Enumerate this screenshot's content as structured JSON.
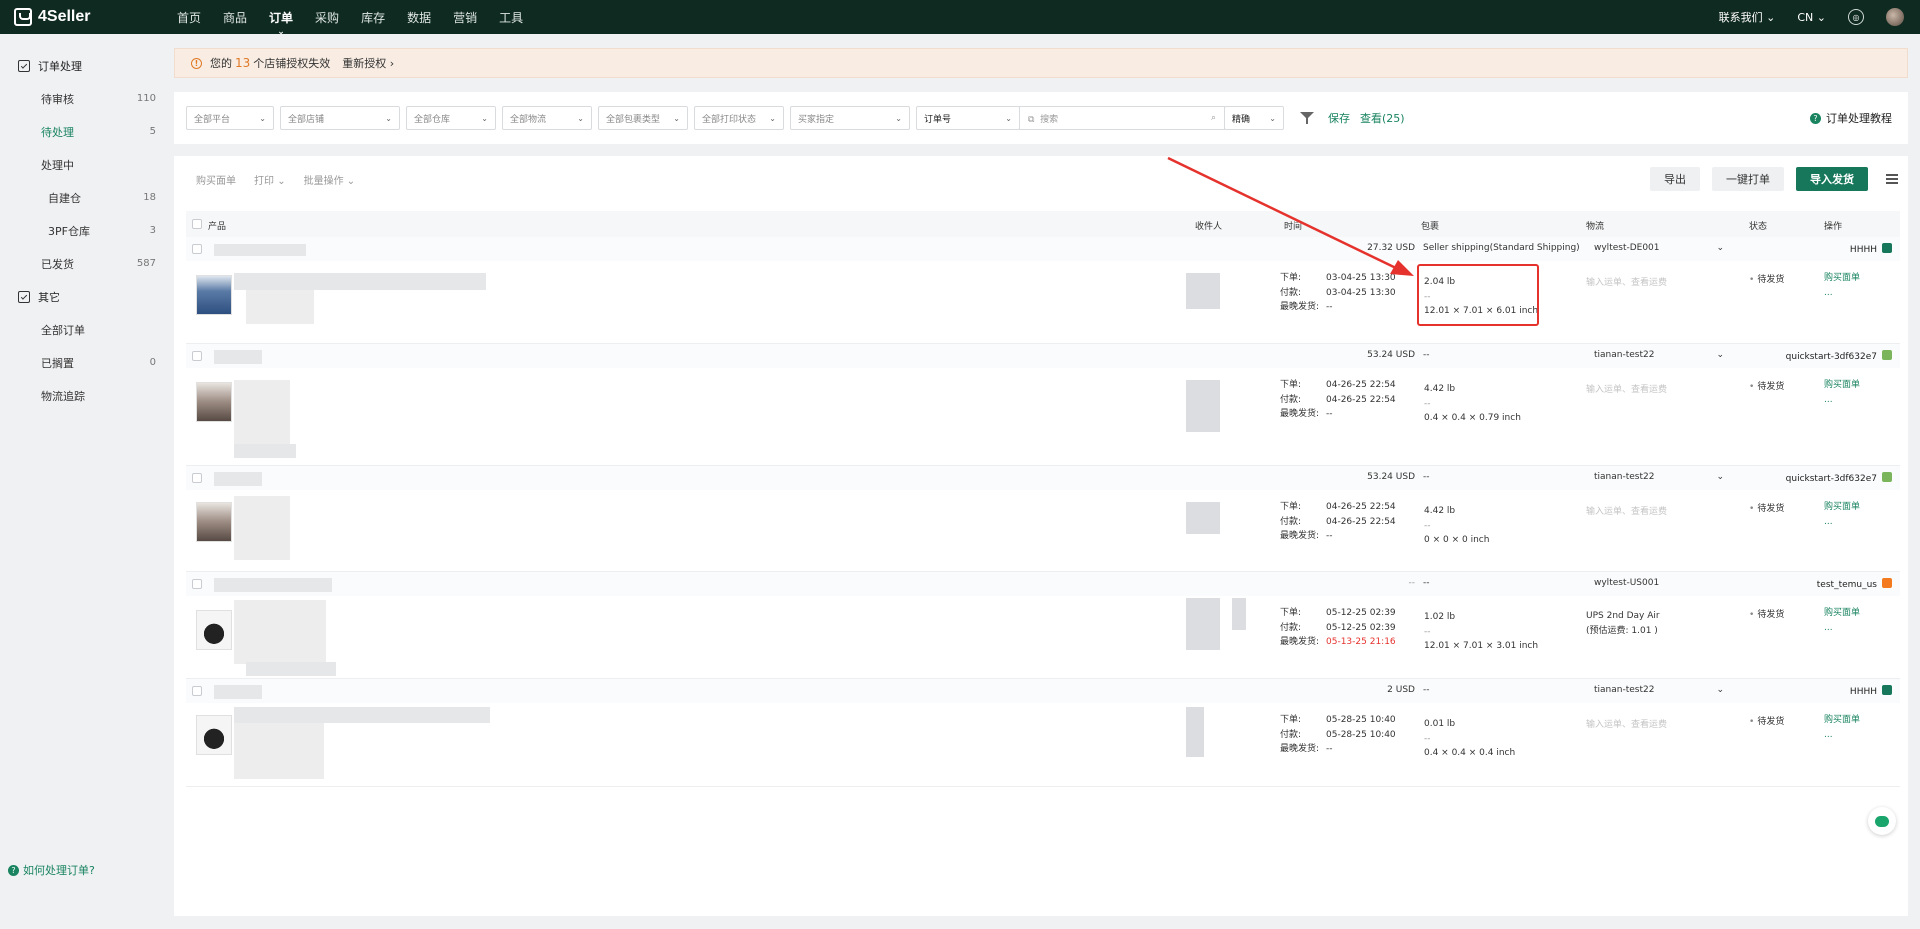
{
  "topnav": {
    "logo": "4Seller",
    "items": [
      "首页",
      "商品",
      "订单",
      "采购",
      "库存",
      "数据",
      "营销",
      "工具"
    ],
    "active_index": 2,
    "contact": "联系我们",
    "lang": "CN"
  },
  "sidebar": {
    "group1": "订单处理",
    "items": [
      {
        "label": "待审核",
        "count": "110"
      },
      {
        "label": "待处理",
        "count": "5"
      },
      {
        "label": "处理中",
        "count": ""
      },
      {
        "label": "自建仓",
        "count": "18"
      },
      {
        "label": "3PF仓库",
        "count": "3"
      },
      {
        "label": "已发货",
        "count": "587"
      }
    ],
    "group2": "其它",
    "items2": [
      {
        "label": "全部订单",
        "count": ""
      },
      {
        "label": "已搁置",
        "count": "0"
      },
      {
        "label": "物流追踪",
        "count": ""
      }
    ],
    "help": "如何处理订单?"
  },
  "alert": {
    "prefix": "您的",
    "count": "13",
    "suffix": "个店铺授权失效",
    "reauth": "重新授权"
  },
  "filters": {
    "platform": "全部平台",
    "store": "全部店铺",
    "warehouse": "全部仓库",
    "logistics": "全部物流",
    "package_type": "全部包裹类型",
    "print_status": "全部打印状态",
    "buyer": "买家指定",
    "order_no": "订单号",
    "search_placeholder": "搜索",
    "match": "精确",
    "save": "保存",
    "view": "查看(25)",
    "tutorial": "订单处理教程"
  },
  "toolbar": {
    "buy_label": "购买面单",
    "print": "打印",
    "batch": "批量操作",
    "export": "导出",
    "one_click": "一键打单",
    "import_ship": "导入发货"
  },
  "columns": {
    "product": "产品",
    "receiver": "收件人",
    "time": "时间",
    "package": "包裹",
    "logistics": "物流",
    "status": "状态",
    "action": "操作"
  },
  "labels": {
    "ordered": "下单:",
    "paid": "付款:",
    "latest": "最晚发货:",
    "tracking_placeholder": "输入运单、查看运费",
    "buy_label": "购买面单",
    "more": "...",
    "dash": "--"
  },
  "orders": [
    {
      "amount": "27.32 USD",
      "pkg_header": "Seller shipping(Standard Shipping)",
      "warehouse": "wyltest-DE001",
      "store": "HHHH",
      "store_type": "green",
      "ordered": "03-04-25 13:30",
      "paid": "03-04-25 13:30",
      "latest": "--",
      "latest_red": false,
      "weight": "2.04 lb",
      "sub": "--",
      "dims": "12.01 × 7.01 × 6.01 inch",
      "logistics": "",
      "logistics2": "",
      "status": "待发货"
    },
    {
      "amount": "53.24 USD",
      "pkg_header": "--",
      "warehouse": "tianan-test22",
      "store": "quickstart-3df632e7",
      "store_type": "shopify",
      "ordered": "04-26-25 22:54",
      "paid": "04-26-25 22:54",
      "latest": "--",
      "latest_red": false,
      "weight": "4.42 lb",
      "sub": "--",
      "dims": "0.4 × 0.4 × 0.79 inch",
      "logistics": "",
      "logistics2": "",
      "status": "待发货"
    },
    {
      "amount": "53.24 USD",
      "pkg_header": "--",
      "warehouse": "tianan-test22",
      "store": "quickstart-3df632e7",
      "store_type": "shopify",
      "ordered": "04-26-25 22:54",
      "paid": "04-26-25 22:54",
      "latest": "--",
      "latest_red": false,
      "weight": "4.42 lb",
      "sub": "--",
      "dims": "0 × 0 × 0 inch",
      "logistics": "",
      "logistics2": "",
      "status": "待发货"
    },
    {
      "amount": "--",
      "pkg_header": "--",
      "warehouse": "wyltest-US001",
      "store": "test_temu_us",
      "store_type": "temu",
      "ordered": "05-12-25 02:39",
      "paid": "05-12-25 02:39",
      "latest": "05-13-25 21:16",
      "latest_red": true,
      "weight": "1.02 lb",
      "sub": "--",
      "dims": "12.01 × 7.01 × 3.01 inch",
      "logistics": "UPS 2nd Day Air",
      "logistics2": "(预估运费: 1.01 )",
      "status": "待发货"
    },
    {
      "amount": "2 USD",
      "pkg_header": "--",
      "warehouse": "tianan-test22",
      "store": "HHHH",
      "store_type": "green",
      "ordered": "05-28-25 10:40",
      "paid": "05-28-25 10:40",
      "latest": "--",
      "latest_red": false,
      "weight": "0.01 lb",
      "sub": "--",
      "dims": "0.4 × 0.4 × 0.4 inch",
      "logistics": "",
      "logistics2": "",
      "status": "待发货"
    }
  ]
}
